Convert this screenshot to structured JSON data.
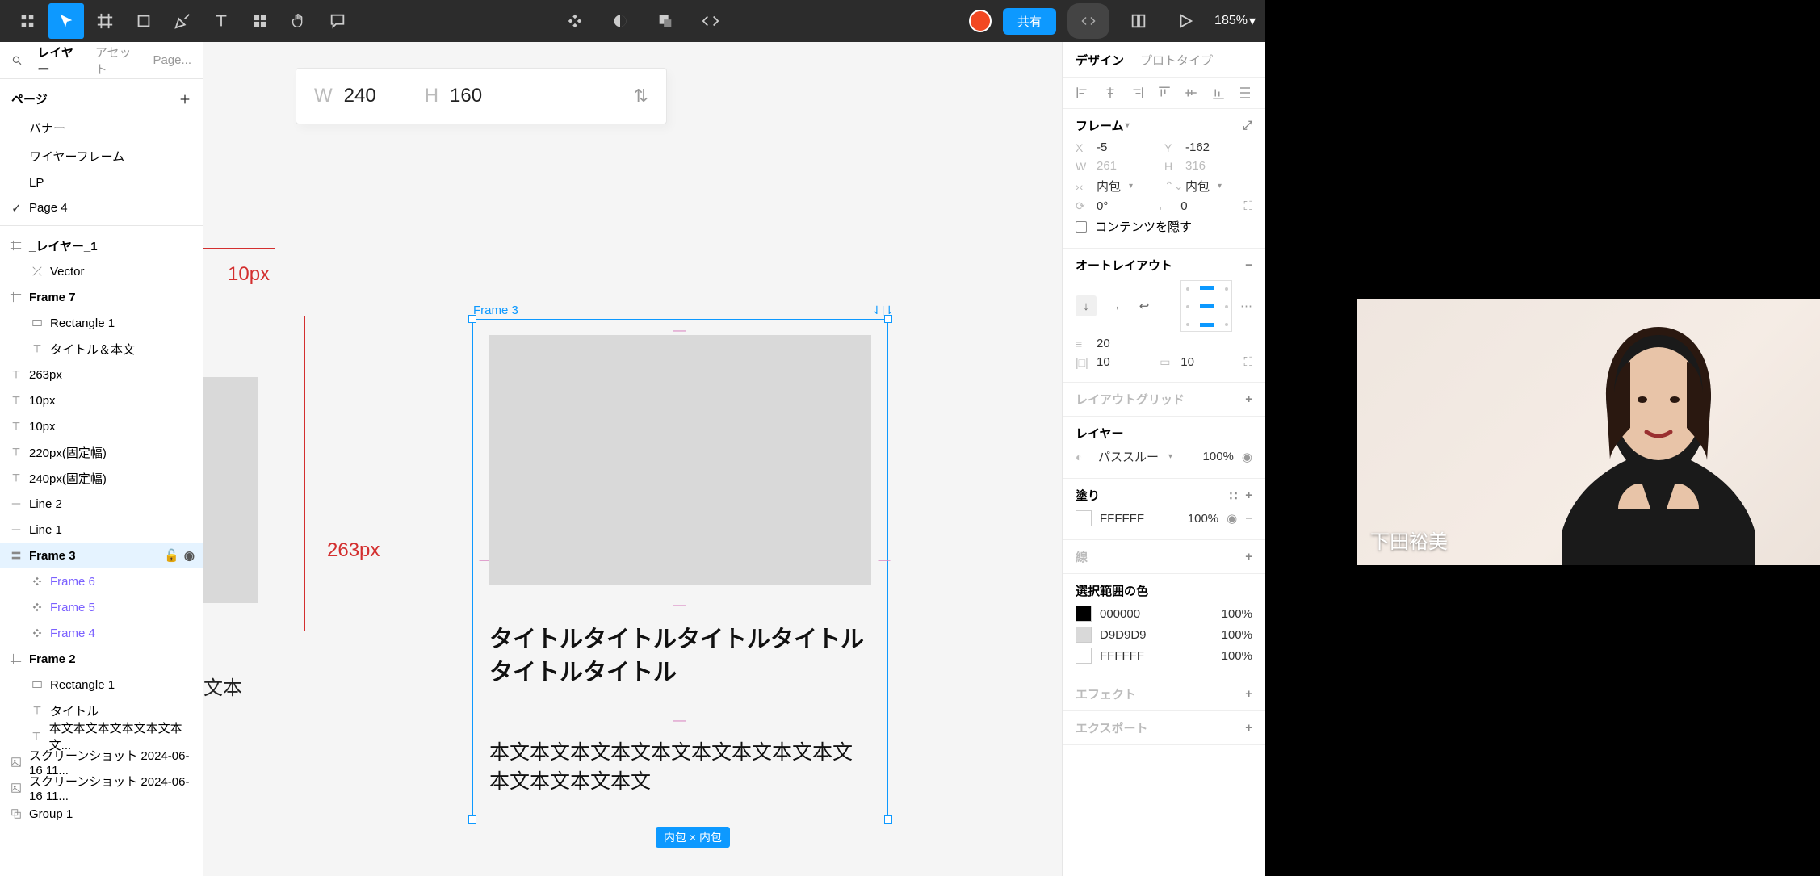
{
  "toolbar": {
    "share_label": "共有",
    "zoom": "185%"
  },
  "left_panel": {
    "tab_layers": "レイヤー",
    "tab_assets": "アセット",
    "tab_page": "Page...",
    "pages_header": "ページ",
    "pages": [
      "バナー",
      "ワイヤーフレーム",
      "LP",
      "Page 4"
    ],
    "active_page": 3,
    "layers": [
      {
        "name": "_レイヤー_1",
        "indent": 0,
        "icon": "frame",
        "bold": true
      },
      {
        "name": "Vector",
        "indent": 1,
        "icon": "vector"
      },
      {
        "name": "Frame 7",
        "indent": 0,
        "icon": "frame",
        "bold": true
      },
      {
        "name": "Rectangle 1",
        "indent": 1,
        "icon": "rect"
      },
      {
        "name": "タイトル＆本文",
        "indent": 1,
        "icon": "text"
      },
      {
        "name": "263px",
        "indent": 0,
        "icon": "text"
      },
      {
        "name": "10px",
        "indent": 0,
        "icon": "text"
      },
      {
        "name": "10px",
        "indent": 0,
        "icon": "text"
      },
      {
        "name": "220px(固定幅)",
        "indent": 0,
        "icon": "text"
      },
      {
        "name": "240px(固定幅)",
        "indent": 0,
        "icon": "text"
      },
      {
        "name": "Line 2",
        "indent": 0,
        "icon": "line"
      },
      {
        "name": "Line 1",
        "indent": 0,
        "icon": "line"
      },
      {
        "name": "Frame 3",
        "indent": 0,
        "icon": "frame-al",
        "bold": true,
        "selected": true,
        "actions": true
      },
      {
        "name": "Frame 6",
        "indent": 1,
        "icon": "comp",
        "comp": true
      },
      {
        "name": "Frame 5",
        "indent": 1,
        "icon": "comp",
        "comp": true
      },
      {
        "name": "Frame 4",
        "indent": 1,
        "icon": "comp",
        "comp": true
      },
      {
        "name": "Frame 2",
        "indent": 0,
        "icon": "frame",
        "bold": true
      },
      {
        "name": "Rectangle 1",
        "indent": 1,
        "icon": "rect"
      },
      {
        "name": "タイトル",
        "indent": 1,
        "icon": "text"
      },
      {
        "name": "本文本文本文本文本文本文...",
        "indent": 1,
        "icon": "text"
      },
      {
        "name": "スクリーンショット 2024-06-16 11...",
        "indent": 0,
        "icon": "image"
      },
      {
        "name": "スクリーンショット 2024-06-16 11...",
        "indent": 0,
        "icon": "image"
      },
      {
        "name": "Group 1",
        "indent": 0,
        "icon": "group"
      }
    ]
  },
  "canvas": {
    "dims_w_label": "W",
    "dims_w_value": "240",
    "dims_h_label": "H",
    "dims_h_value": "160",
    "anno_10px": "10px",
    "anno_263px": "263px",
    "anno_body": "文本",
    "frame_label": "Frame 3",
    "al_badge": "⇃|⇂",
    "card_title": "タイトルタイトルタイトルタイトルタイトルタイトル",
    "card_body": "本文本文本文本文本文本文本文本文本文本文本文本文本文",
    "gap_mark": "—",
    "sel_badge": "内包 × 内包"
  },
  "right_panel": {
    "tab_design": "デザイン",
    "tab_proto": "プロトタイプ",
    "frame_header": "フレーム",
    "x_label": "X",
    "x_val": "-5",
    "y_label": "Y",
    "y_val": "-162",
    "w_label": "W",
    "w_val": "261",
    "h_label": "H",
    "h_val": "316",
    "hug_h": "内包",
    "hug_v": "内包",
    "rot_label": "⟳",
    "rot_val": "0°",
    "rad_label": "⌐",
    "rad_val": "0",
    "clip_label": "コンテンツを隠す",
    "al_header": "オートレイアウト",
    "al_gap_label": "⫴",
    "al_gap_val": "20",
    "al_padh_label": "|□|",
    "al_padh_val": "10",
    "al_padv_label": "▭",
    "al_padv_val": "10",
    "grid_header": "レイアウトグリッド",
    "layer_header": "レイヤー",
    "blend_label": "パススルー",
    "blend_val": "100%",
    "fill_header": "塗り",
    "fill_hex": "FFFFFF",
    "fill_opa": "100%",
    "stroke_header": "線",
    "selcolor_header": "選択範囲の色",
    "selcolors": [
      {
        "hex": "000000",
        "opa": "100%",
        "sw": "#000000"
      },
      {
        "hex": "D9D9D9",
        "opa": "100%",
        "sw": "#d9d9d9"
      },
      {
        "hex": "FFFFFF",
        "opa": "100%",
        "sw": "#ffffff"
      }
    ],
    "effect_header": "エフェクト",
    "export_header": "エクスポート"
  },
  "webcam": {
    "name": "下田裕美"
  }
}
